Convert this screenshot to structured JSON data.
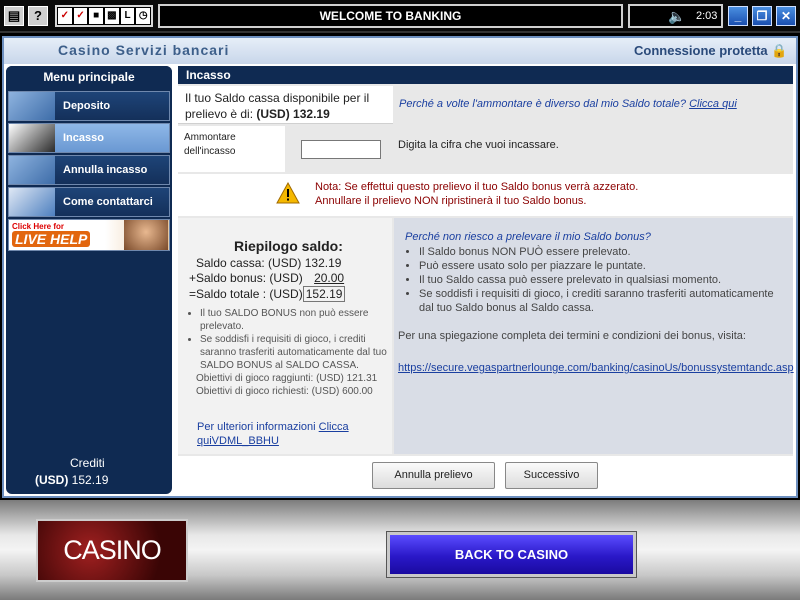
{
  "topbar": {
    "title": "WELCOME TO BANKING",
    "time": "2:03",
    "left_icons": [
      "menu-icon",
      "help-icon"
    ],
    "game_icons": [
      "game-icon-1",
      "game-icon-2",
      "game-icon-3",
      "game-icon-4",
      "game-icon-5",
      "game-icon-6"
    ],
    "window_buttons": [
      "minimize",
      "restore",
      "close"
    ]
  },
  "header": {
    "title": "Casino Servizi bancari",
    "secure": "Connessione protetta"
  },
  "sidebar": {
    "title": "Menu principale",
    "items": [
      {
        "label": "Deposito",
        "active": false
      },
      {
        "label": "Incasso",
        "active": true
      },
      {
        "label": "Annulla incasso",
        "active": false
      },
      {
        "label": "Come contattarci",
        "active": false
      }
    ],
    "livehelp": {
      "small": "Click Here for",
      "big": "LIVE HELP"
    },
    "credits_label": "Crediti",
    "credits_currency": "(USD)",
    "credits_value": "152.19"
  },
  "content": {
    "title": "Incasso",
    "balance_label": "Il tuo Saldo cassa disponibile per il prelievo è di:",
    "balance_value": "(USD) 132.19",
    "why_text": "Perché a volte l'ammontare è diverso dal mio Saldo totale?",
    "why_link": "Clicca qui",
    "amount_label": "Ammontare dell'incasso",
    "amount_value": "",
    "amount_hint": "Digita la cifra che vuoi incassare.",
    "warning_line1": "Nota: Se effettui questo prelievo il tuo Saldo bonus verrà azzerato.",
    "warning_line2": "Annullare il prelievo NON ripristinerà il tuo Saldo bonus.",
    "summary": {
      "title": "Riepilogo saldo:",
      "cash_label": "Saldo cassa: (USD)",
      "cash_value": "132.19",
      "bonus_label": "+Saldo bonus: (USD)",
      "bonus_value": "20.00",
      "total_label": "=Saldo totale : (USD)",
      "total_value": "152.19",
      "notes": [
        "Il tuo SALDO BONUS non può essere prelevato.",
        "Se soddisfi i requisiti di gioco, i crediti saranno trasferiti automaticamente dal tuo SALDO BONUS al SALDO CASSA."
      ],
      "reached_label": "Obiettivi di gioco raggiunti: (USD) 121.31",
      "required_label": "Obiettivi di gioco richiesti: (USD) 600.00",
      "more_info": "Per ulteriori informazioni",
      "more_info_link": "Clicca quiVDML_BBHU"
    },
    "why_not": {
      "title": "Perché non riesco a prelevare il mio Saldo bonus?",
      "items": [
        "Il Saldo bonus NON PUÒ essere prelevato.",
        "Può essere usato solo per piazzare le puntate.",
        "Il tuo Saldo cassa può essere prelevato in qualsiasi momento.",
        "Se soddisfi i requisiti di gioco, i crediti saranno trasferiti automaticamente dal tuo Saldo bonus al Saldo cassa."
      ],
      "full_explanation": "Per una spiegazione completa dei termini e condizioni dei bonus, visita:",
      "link": "https://secure.vegaspartnerlounge.com/banking/casinoUs/bonussystemtandc.asp"
    },
    "buttons": {
      "cancel": "Annulla prelievo",
      "next": "Successivo"
    }
  },
  "bottom": {
    "logo": "CASINO",
    "back": "BACK TO CASINO"
  }
}
